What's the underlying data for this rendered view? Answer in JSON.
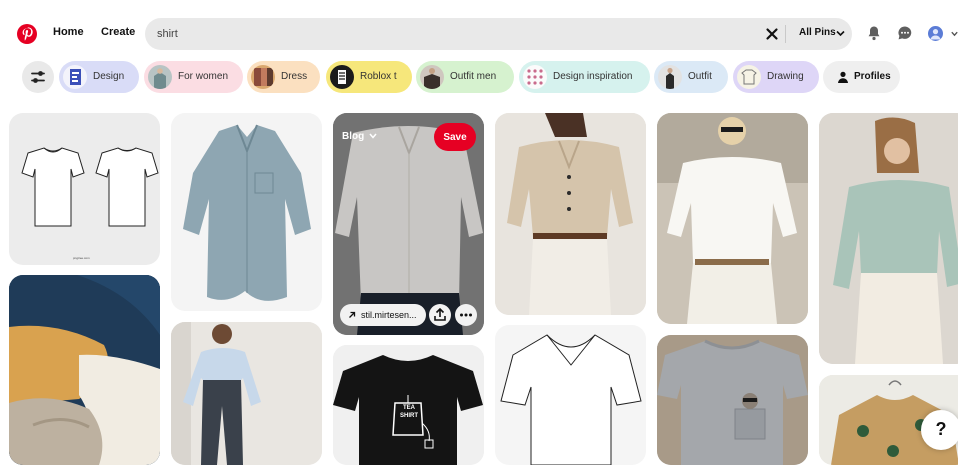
{
  "header": {
    "logo_icon": "pinterest-logo-icon",
    "nav": {
      "home": "Home",
      "create": "Create"
    },
    "search": {
      "value": "shirt",
      "scope": "All Pins",
      "clear_icon": "close-icon"
    },
    "icons": [
      "bell-icon",
      "chat-bubble-icon",
      "avatar",
      "chevron-down-icon"
    ]
  },
  "chips": {
    "filter_icon": "sliders-icon",
    "items": [
      {
        "label": "Design",
        "bg": "#d9dcf7"
      },
      {
        "label": "For women",
        "bg": "#fbdde3"
      },
      {
        "label": "Dress",
        "bg": "#fbe0c0"
      },
      {
        "label": "Roblox t",
        "bg": "#f6e77b"
      },
      {
        "label": "Outfit men",
        "bg": "#d6f2cf"
      },
      {
        "label": "Design inspiration",
        "bg": "#d6f2ee"
      },
      {
        "label": "Outfit",
        "bg": "#dbe9f6"
      },
      {
        "label": "Drawing",
        "bg": "#ded6f7"
      }
    ],
    "profiles": {
      "label": "Profiles",
      "icon": "person-icon"
    }
  },
  "pins": {
    "sketch_caption": "pngtree.com",
    "hovered": {
      "board": "Blog",
      "save": "Save",
      "source": "stil.mirtesen...",
      "icons": [
        "arrow-up-right-icon",
        "share-icon",
        "more-icon"
      ]
    },
    "tea_print": {
      "line1": "TEA",
      "line2": "SHIRT"
    }
  },
  "help": {
    "label": "?"
  },
  "colors": {
    "brand": "#e60023",
    "surface": "#e9e9e9"
  }
}
